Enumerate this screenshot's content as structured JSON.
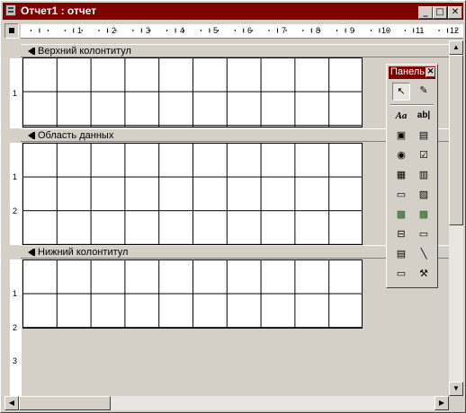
{
  "window": {
    "title": "Отчет1 : отчет",
    "controls": {
      "minimize": "_",
      "maximize": "□",
      "close": "✕"
    }
  },
  "ruler": {
    "top_numbers": [
      "1",
      "2",
      "3",
      "4",
      "5",
      "6",
      "7",
      "8",
      "9",
      "10",
      "11",
      "12"
    ],
    "left_header": [
      "1"
    ],
    "left_detail": [
      "1",
      "2"
    ],
    "left_footer": [
      "1",
      "2",
      "3"
    ]
  },
  "sections": {
    "header": {
      "label": "Верхний колонтитул"
    },
    "detail": {
      "label": "Область данных"
    },
    "footer": {
      "label": "Нижний колонтитул"
    }
  },
  "toolbox": {
    "title": "Панель",
    "close": "✕",
    "tools": [
      {
        "name": "select-objects-icon",
        "glyph": "↖"
      },
      {
        "name": "control-wizards-icon",
        "glyph": "✎"
      },
      {
        "name": "label-icon",
        "glyph": "Aa"
      },
      {
        "name": "text-box-icon",
        "glyph": "ab|"
      },
      {
        "name": "option-group-icon",
        "glyph": "▣"
      },
      {
        "name": "toggle-button-icon",
        "glyph": "▤"
      },
      {
        "name": "option-button-icon",
        "glyph": "◉"
      },
      {
        "name": "check-box-icon",
        "glyph": "☑"
      },
      {
        "name": "combo-box-icon",
        "glyph": "▦"
      },
      {
        "name": "list-box-icon",
        "glyph": "▥"
      },
      {
        "name": "command-button-icon",
        "glyph": "▭"
      },
      {
        "name": "image-icon",
        "glyph": "▨"
      },
      {
        "name": "unbound-object-frame-icon",
        "glyph": "▩"
      },
      {
        "name": "bound-object-frame-icon",
        "glyph": "▩"
      },
      {
        "name": "page-break-icon",
        "glyph": "⊟"
      },
      {
        "name": "tab-control-icon",
        "glyph": "▭"
      },
      {
        "name": "subform-icon",
        "glyph": "▤"
      },
      {
        "name": "line-icon",
        "glyph": "╲"
      },
      {
        "name": "rectangle-icon",
        "glyph": "▭"
      },
      {
        "name": "more-controls-icon",
        "glyph": "⚒"
      }
    ]
  }
}
